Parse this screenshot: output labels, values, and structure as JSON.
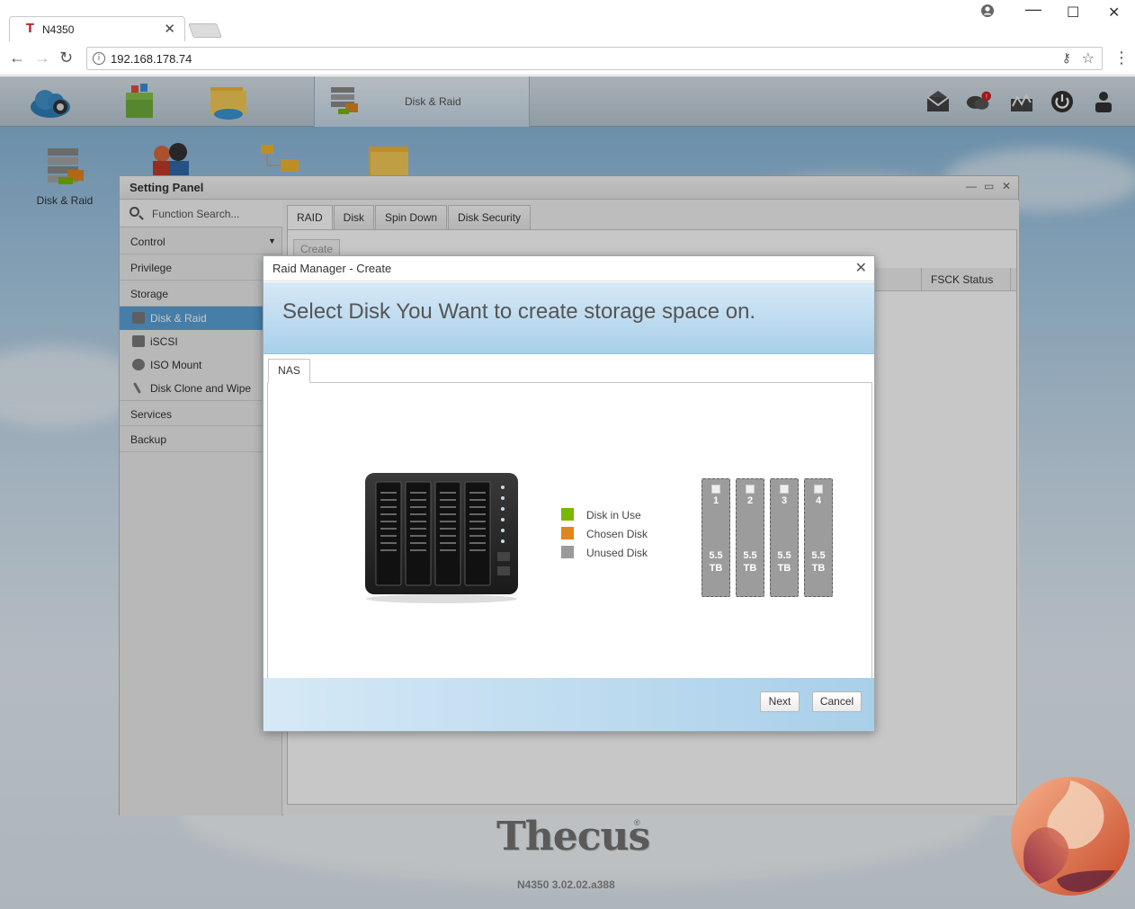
{
  "browser": {
    "tab_title": "N4350",
    "tab_favicon": "T",
    "url": "192.168.178.74"
  },
  "topbar": {
    "active_app_label": "Disk & Raid"
  },
  "desktop": {
    "icons": [
      {
        "label": "Disk & Raid"
      }
    ]
  },
  "setting_panel": {
    "title": "Setting Panel",
    "search_placeholder": "Function Search...",
    "menu": {
      "control": "Control",
      "privilege": "Privilege",
      "storage": "Storage",
      "storage_items": [
        "Disk & Raid",
        "iSCSI",
        "ISO Mount",
        "Disk Clone and Wipe"
      ],
      "services": "Services",
      "backup": "Backup"
    },
    "tabs": [
      "RAID",
      "Disk",
      "Spin Down",
      "Disk Security"
    ],
    "create_label": "Create",
    "fsck_header": "FSCK Status"
  },
  "modal": {
    "title": "Raid Manager - Create",
    "banner": "Select Disk You Want to create storage space on.",
    "tab": "NAS",
    "legend": [
      {
        "label": "Disk in Use",
        "color": "#7ab800"
      },
      {
        "label": "Chosen Disk",
        "color": "#e0861f"
      },
      {
        "label": "Unused Disk",
        "color": "#9a9a9a"
      }
    ],
    "disks": [
      {
        "number": "1",
        "size": "5.5",
        "unit": "TB"
      },
      {
        "number": "2",
        "size": "5.5",
        "unit": "TB"
      },
      {
        "number": "3",
        "size": "5.5",
        "unit": "TB"
      },
      {
        "number": "4",
        "size": "5.5",
        "unit": "TB"
      }
    ],
    "next_label": "Next",
    "cancel_label": "Cancel"
  },
  "footer": {
    "brand": "Thecus",
    "brand_mark": "®",
    "version": "N4350 3.02.02.a388"
  },
  "icons": {
    "tab_close": "close-icon",
    "search": "search-icon",
    "device": "nas-device-icon"
  }
}
